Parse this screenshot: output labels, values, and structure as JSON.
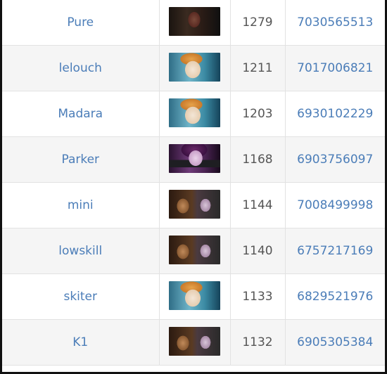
{
  "leaderboard": {
    "rows": [
      {
        "name": "Pure",
        "hero": "hero-dark-portrait",
        "mmr": "1279",
        "player_id": "7030565513"
      },
      {
        "name": "lelouch",
        "hero": "hero-blonde-portrait",
        "mmr": "1211",
        "player_id": "7017006821"
      },
      {
        "name": "Madara",
        "hero": "hero-blonde-portrait",
        "mmr": "1203",
        "player_id": "6930102229"
      },
      {
        "name": "Parker",
        "hero": "hero-masked-portrait",
        "mmr": "1168",
        "player_id": "6903756097"
      },
      {
        "name": "mini",
        "hero": "hero-duo-portrait",
        "mmr": "1144",
        "player_id": "7008499998"
      },
      {
        "name": "lowskill",
        "hero": "hero-duo-portrait",
        "mmr": "1140",
        "player_id": "6757217169"
      },
      {
        "name": "skiter",
        "hero": "hero-blonde-portrait",
        "mmr": "1133",
        "player_id": "6829521976"
      },
      {
        "name": "K1",
        "hero": "hero-duo-portrait",
        "mmr": "1132",
        "player_id": "6905305384"
      }
    ]
  },
  "colors": {
    "link": "#4b7db8",
    "text": "#555555",
    "row_alt": "#f5f5f5",
    "border": "#e2e2e2",
    "outer_background": "#111111"
  }
}
